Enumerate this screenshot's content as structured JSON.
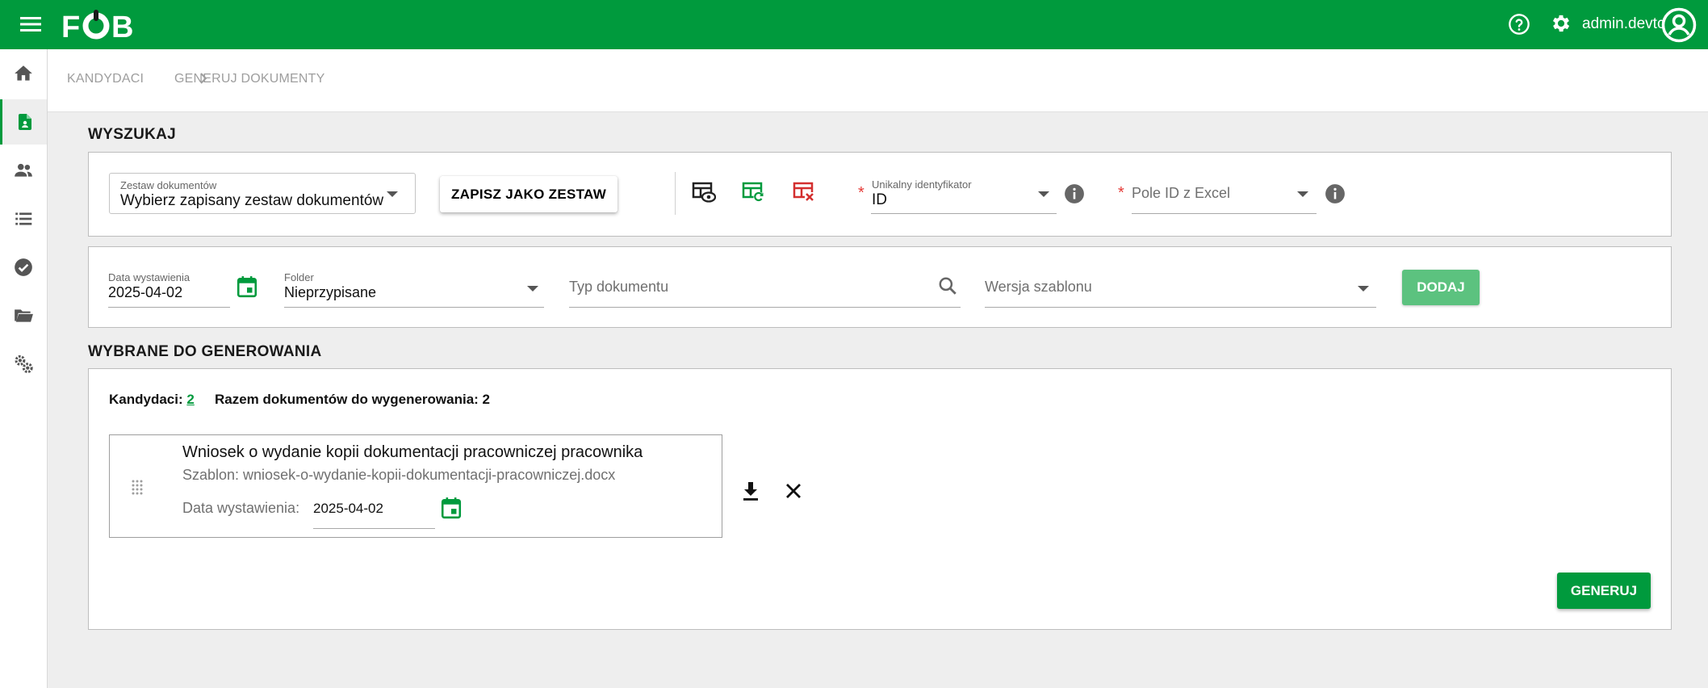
{
  "app": {
    "logo_text": "FOB",
    "user": "admin.devtc"
  },
  "colors": {
    "brand": "#009a3d",
    "add_button": "#5cc27f",
    "delete_icon": "#d32f2f"
  },
  "icons": {
    "menu": "menu-icon",
    "help": "help-circle-icon",
    "settings": "gear-icon",
    "avatar": "account-circle-icon",
    "sidebar": [
      "home-icon",
      "document-person-icon",
      "people-icon",
      "list-icon",
      "check-circle-icon",
      "folder-open-icon",
      "gears-icon"
    ]
  },
  "breadcrumb": {
    "items": [
      "KANDYDACI",
      "GENERUJ DOKUMENTY"
    ]
  },
  "search": {
    "title": "WYSZUKAJ",
    "doc_set_label": "Zestaw dokumentów",
    "doc_set_value": "Wybierz zapisany zestaw dokumentów",
    "save_set_button": "ZAPISZ JAKO ZESTAW",
    "unique_id_label": "Unikalny identyfikator",
    "unique_id_value": "ID",
    "excel_id_placeholder": "Pole ID z Excel",
    "required_mark": "*"
  },
  "filters": {
    "date_label": "Data wystawienia",
    "date_value": "2025-04-02",
    "folder_label": "Folder",
    "folder_value": "Nieprzypisane",
    "doc_type_placeholder": "Typ dokumentu",
    "template_version_placeholder": "Wersja szablonu",
    "add_button": "DODAJ"
  },
  "selected": {
    "title": "WYBRANE DO GENEROWANIA",
    "candidates_label": "Kandydaci:",
    "candidates_count": "2",
    "total_label": "Razem dokumentów do wygenerowania: 2",
    "documents": [
      {
        "title": "Wniosek o wydanie kopii dokumentacji pracowniczej pracownika",
        "template": "Szablon: wniosek-o-wydanie-kopii-dokumentacji-pracowniczej.docx",
        "date_label": "Data wystawienia:",
        "date_value": "2025-04-02"
      }
    ],
    "generate_button": "GENERUJ"
  }
}
